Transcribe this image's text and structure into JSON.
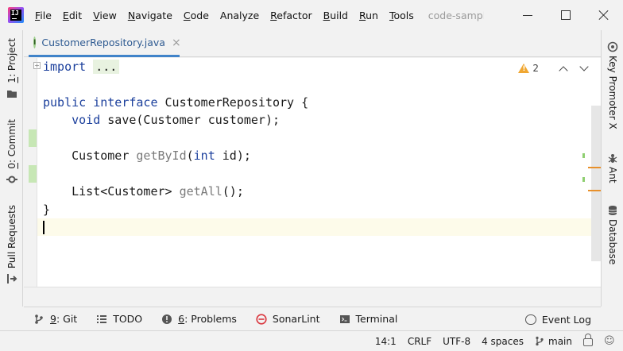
{
  "menu": {
    "items": [
      {
        "mn": "F",
        "rest": "ile"
      },
      {
        "mn": "E",
        "rest": "dit"
      },
      {
        "mn": "V",
        "rest": "iew"
      },
      {
        "mn": "N",
        "rest": "avigate"
      },
      {
        "mn": "C",
        "rest": "ode"
      },
      {
        "mn": "",
        "rest": "Analyze"
      },
      {
        "mn": "R",
        "rest": "efactor"
      },
      {
        "mn": "B",
        "rest": "uild"
      },
      {
        "mn": "R",
        "rest": "un"
      },
      {
        "mn": "T",
        "rest": "ools"
      }
    ],
    "project_hint": "code-sample"
  },
  "left_stripe": {
    "project": {
      "mn": "1",
      "rest": ": Project"
    },
    "commit": {
      "mn": "0",
      "rest": ": Commit"
    },
    "pull_requests": "Pull Requests"
  },
  "right_stripe": {
    "key_promoter": "Key Promoter X",
    "ant": "Ant",
    "database": "Database"
  },
  "editor": {
    "tab": {
      "badge": "I",
      "filename": "CustomerRepository.java"
    },
    "warnings_count": "2",
    "lines": {
      "l1_kw": "import",
      "l1_dots": "...",
      "l3_kw1": "public",
      "l3_kw2": "interface",
      "l3_name": "CustomerRepository {",
      "l4_kw": "void",
      "l4_name": "save",
      "l4_rest": "(Customer customer);",
      "l6_type": "Customer",
      "l6_name": "getById",
      "l6_open": "(",
      "l6_kw": "int",
      "l6_rest": " id);",
      "l8_type": "List<Customer>",
      "l8_name": "getAll",
      "l8_rest": "();",
      "l9": "}"
    }
  },
  "bottom_tools": {
    "git": {
      "mn": "9",
      "rest": ": Git"
    },
    "todo": "TODO",
    "problems": {
      "mn": "6",
      "rest": ": Problems"
    },
    "sonarlint": "SonarLint",
    "terminal": "Terminal",
    "event_log": "Event Log"
  },
  "status": {
    "position": "14:1",
    "line_sep": "CRLF",
    "encoding": "UTF-8",
    "indent": "4 spaces",
    "branch": "main"
  },
  "colors": {
    "keyword": "#1b3f9c",
    "tab_underline": "#4083c9",
    "vcs_added": "#c7e7b5",
    "warning": "#f0a732"
  }
}
